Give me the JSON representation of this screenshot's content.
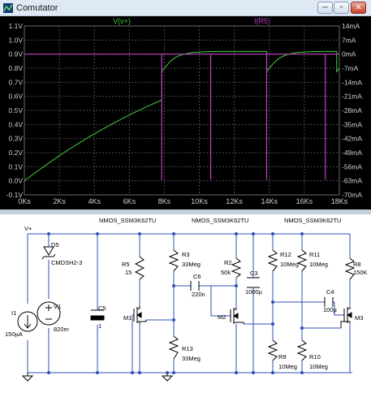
{
  "window": {
    "title": "Comutator",
    "min_label": "─",
    "max_label": "▫",
    "close_label": "✕"
  },
  "chart_data": {
    "type": "line",
    "background": "#000000",
    "series": [
      {
        "name": "V(v+)",
        "color": "#3dd13d",
        "axis": "left",
        "x": [
          0,
          200,
          400,
          600,
          800,
          1000,
          1200,
          1400,
          1600,
          1800,
          2000,
          2200,
          2400,
          2600,
          2800,
          3000,
          3200,
          3400,
          3600,
          3800,
          4000,
          4200,
          4400,
          4600,
          4800,
          5000,
          5200,
          5400,
          5600,
          5800,
          6000,
          6200,
          6400,
          6600,
          6800,
          7000,
          7200,
          7400,
          7600,
          7800,
          7850,
          7851,
          8000,
          8200,
          8400,
          8600,
          8800,
          9000,
          9200,
          9400,
          9600,
          9800,
          10000,
          10200,
          10400,
          10600,
          10800,
          11000,
          11200,
          11400,
          11600,
          11800,
          12000,
          12200,
          12400,
          12600,
          12800,
          13000,
          13200,
          13400,
          13600,
          13800,
          13850,
          13851,
          14000,
          14200,
          14400,
          14600,
          14800,
          15000,
          15200,
          15400,
          15600,
          15800,
          16000,
          16200,
          16400,
          16600,
          16800,
          17000,
          17200,
          17400,
          17600,
          17800,
          17850,
          17851,
          18000
        ],
        "y": [
          0.0,
          0.018,
          0.037,
          0.055,
          0.073,
          0.091,
          0.109,
          0.126,
          0.144,
          0.161,
          0.178,
          0.194,
          0.211,
          0.227,
          0.243,
          0.258,
          0.274,
          0.289,
          0.304,
          0.319,
          0.333,
          0.348,
          0.362,
          0.376,
          0.389,
          0.403,
          0.416,
          0.429,
          0.442,
          0.455,
          0.467,
          0.48,
          0.492,
          0.504,
          0.515,
          0.527,
          0.538,
          0.549,
          0.56,
          0.571,
          0.575,
          0.775,
          0.8,
          0.83,
          0.855,
          0.873,
          0.886,
          0.895,
          0.902,
          0.907,
          0.911,
          0.913,
          0.915,
          0.916,
          0.917,
          0.918,
          0.918,
          0.919,
          0.919,
          0.919,
          0.919,
          0.919,
          0.919,
          0.919,
          0.919,
          0.919,
          0.919,
          0.919,
          0.919,
          0.919,
          0.919,
          0.919,
          0.919,
          0.775,
          0.8,
          0.83,
          0.855,
          0.873,
          0.886,
          0.895,
          0.902,
          0.907,
          0.911,
          0.913,
          0.915,
          0.916,
          0.917,
          0.918,
          0.918,
          0.919,
          0.919,
          0.919,
          0.919,
          0.919,
          0.919,
          0.775,
          0.8
        ]
      },
      {
        "name": "I(R5)",
        "color": "#c040c0",
        "axis": "right",
        "baseline": 0,
        "spikes_x": [
          7850,
          10650,
          13850,
          17200
        ],
        "spike_min": -62.5
      }
    ],
    "x_ticks": [
      "0Ks",
      "2Ks",
      "4Ks",
      "6Ks",
      "8Ks",
      "10Ks",
      "12Ks",
      "14Ks",
      "16Ks",
      "18Ks"
    ],
    "xlim": [
      0,
      18000
    ],
    "y_left_ticks": [
      "-0.1V",
      "0.0V",
      "0.1V",
      "0.2V",
      "0.3V",
      "0.4V",
      "0.5V",
      "0.6V",
      "0.7V",
      "0.8V",
      "0.9V",
      "1.0V",
      "1.1V"
    ],
    "ylim_left": [
      -0.1,
      1.1
    ],
    "y_right_ticks": [
      "-70mA",
      "-63mA",
      "-56mA",
      "-49mA",
      "-42mA",
      "-35mA",
      "-28mA",
      "-21mA",
      "-14mA",
      "-7mA",
      "0mA",
      "7mA",
      "14mA"
    ],
    "ylim_right": [
      -70,
      14
    ],
    "grid": true
  },
  "schematic": {
    "wire_color": "#3050b8",
    "component_color": "#000000",
    "labels": {
      "vplus": "V+",
      "nmos1": "NMOS_SSM3K62TU",
      "nmos2": "NMOS_SSM3K62TU",
      "nmos3": "NMOS_SSM3K62TU",
      "d5": "D5",
      "d5_part": "CMDSH2-3",
      "i1": "I1",
      "i1_val": "150µA",
      "v1": "V1",
      "v1_val": "820m",
      "c5": "C5",
      "c5_val": "1",
      "r5": "R5",
      "r5_val": "15",
      "m1": "M1",
      "r3": "R3",
      "r3_val": "33Meg",
      "c6": "C6",
      "c6_val": "220n",
      "r2": "R2",
      "r2_val": "50k",
      "c3": "C3",
      "c3_val": "1000µ",
      "r13": "R13",
      "r13_val": "33Meg",
      "m2": "M2",
      "r12": "R12",
      "r12_val": "10Meg",
      "r11": "R11",
      "r11_val": "10Meg",
      "c4": "C4",
      "c4_val": "100µ",
      "r8": "R8",
      "r8_val": "150K",
      "m3": "M3",
      "r9": "R9",
      "r9_val": "10Meg",
      "r10": "R10",
      "r10_val": "10Meg"
    }
  }
}
